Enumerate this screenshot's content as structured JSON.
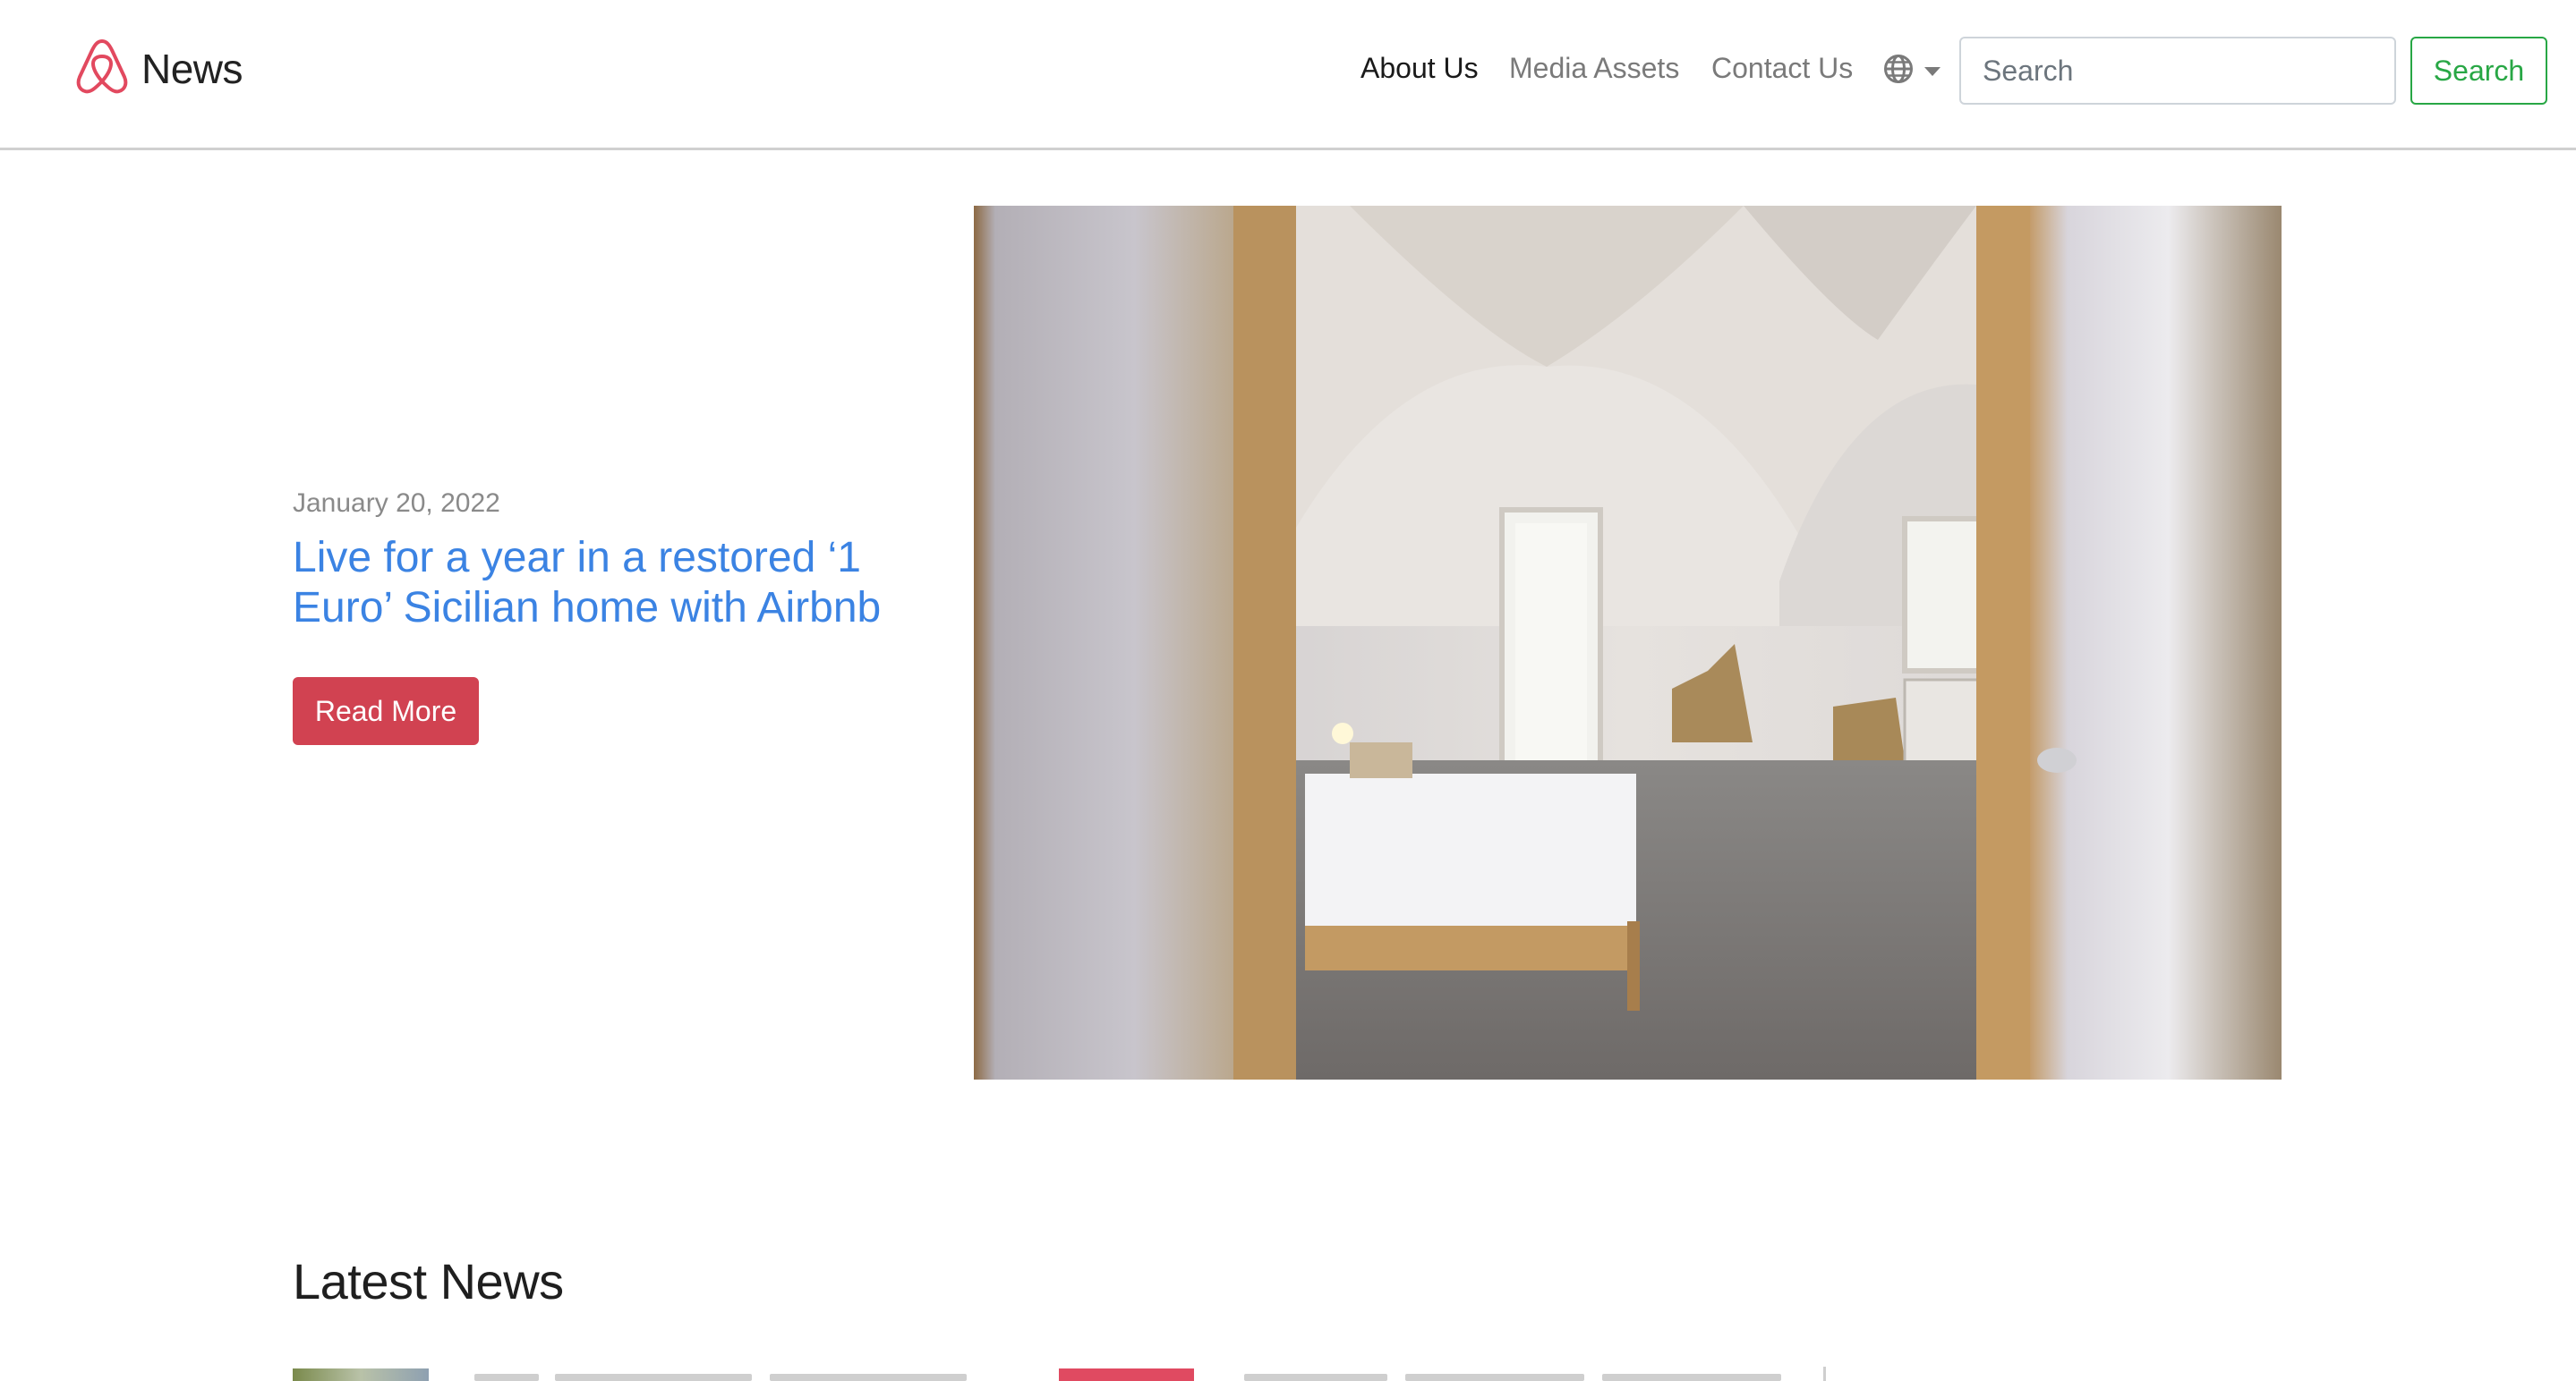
{
  "brand": {
    "name": "News",
    "logo_icon": "airbnb-belo-icon",
    "logo_color": "#e2495f"
  },
  "nav": {
    "links": [
      {
        "label": "About Us",
        "active": true
      },
      {
        "label": "Media Assets",
        "active": false
      },
      {
        "label": "Contact Us",
        "active": false
      }
    ],
    "language_icon": "globe-icon"
  },
  "search": {
    "placeholder": "Search",
    "button_label": "Search",
    "button_color": "#28a745"
  },
  "hero": {
    "date": "January 20, 2022",
    "title": "Live for a year in a restored ‘1 Euro’ Sicilian home with Airbnb",
    "cta_label": "Read More",
    "cta_color": "#d14251",
    "title_color": "#3b83e3",
    "image_icon": "bedroom-photo"
  },
  "latest_news": {
    "heading": "Latest News"
  }
}
